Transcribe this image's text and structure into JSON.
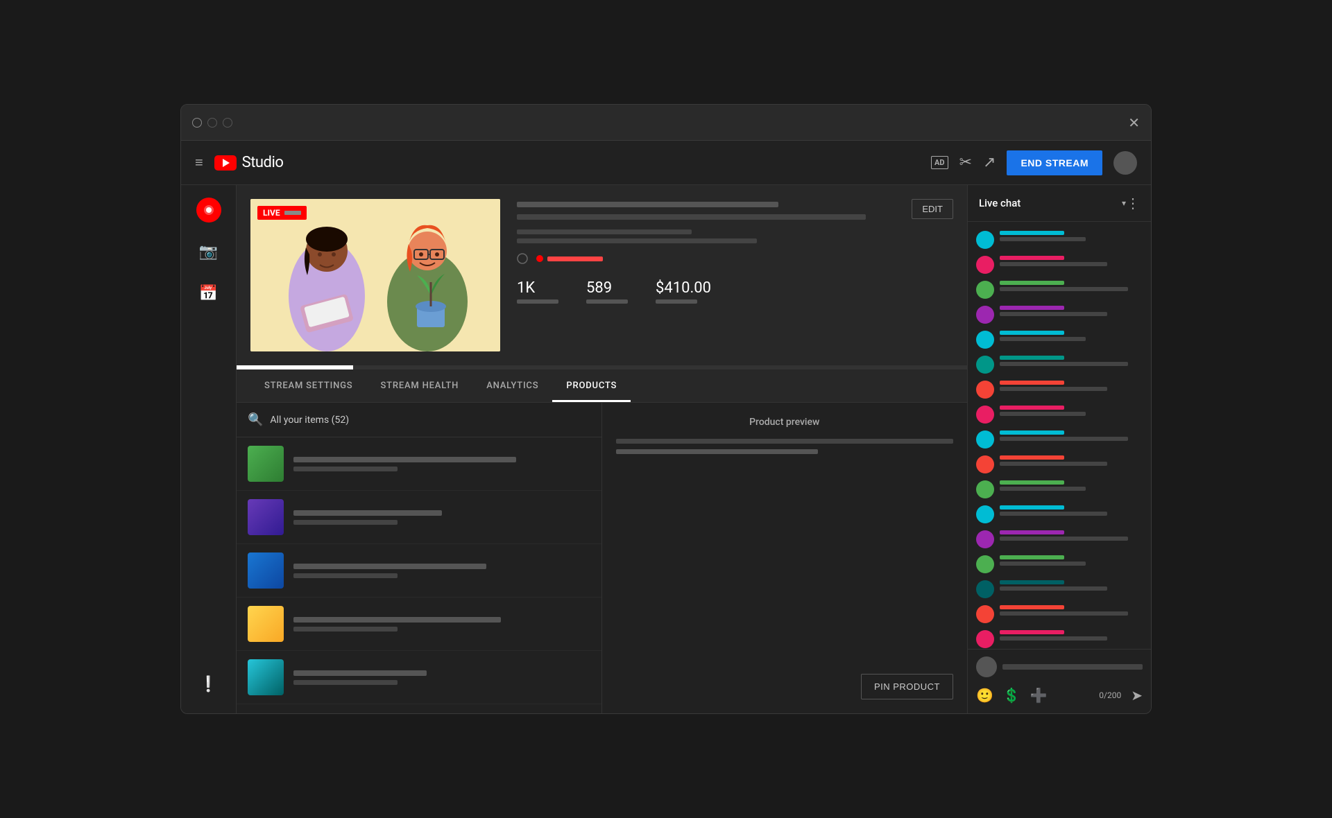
{
  "window": {
    "title": "YouTube Studio"
  },
  "header": {
    "hamburger_icon": "≡",
    "logo_text": "Studio",
    "ad_label": "AD",
    "end_stream_label": "END STREAM"
  },
  "stream": {
    "live_badge": "LIVE",
    "edit_button": "EDIT",
    "stats": {
      "viewers": "1K",
      "likes": "589",
      "revenue": "$410.00"
    }
  },
  "tabs": [
    {
      "id": "stream-settings",
      "label": "STREAM SETTINGS",
      "active": false
    },
    {
      "id": "stream-health",
      "label": "STREAM HEALTH",
      "active": false
    },
    {
      "id": "analytics",
      "label": "ANALYTICS",
      "active": false
    },
    {
      "id": "products",
      "label": "PRODUCTS",
      "active": true
    }
  ],
  "products": {
    "search_text": "All your items (52)",
    "preview_title": "Product preview",
    "pin_button": "PIN PRODUCT",
    "items": [
      {
        "id": 1,
        "color_class": "product-img-1"
      },
      {
        "id": 2,
        "color_class": "product-img-2"
      },
      {
        "id": 3,
        "color_class": "product-img-3"
      },
      {
        "id": 4,
        "color_class": "product-img-4"
      },
      {
        "id": 5,
        "color_class": "product-img-5"
      }
    ]
  },
  "chat": {
    "title": "Live chat",
    "dropdown_icon": "▾",
    "more_icon": "⋮",
    "char_count": "0/200",
    "avatars": [
      {
        "color": "#00bcd4"
      },
      {
        "color": "#e91e63"
      },
      {
        "color": "#4caf50"
      },
      {
        "color": "#9c27b0"
      },
      {
        "color": "#00bcd4"
      },
      {
        "color": "#009688"
      },
      {
        "color": "#f44336"
      },
      {
        "color": "#e91e63"
      },
      {
        "color": "#00bcd4"
      },
      {
        "color": "#f44336"
      },
      {
        "color": "#4caf50"
      },
      {
        "color": "#00bcd4"
      },
      {
        "color": "#9c27b0"
      },
      {
        "color": "#4caf50"
      },
      {
        "color": "#006064"
      },
      {
        "color": "#f44336"
      },
      {
        "color": "#e91e63"
      },
      {
        "color": "#00bcd4"
      },
      {
        "color": "#009688"
      },
      {
        "color": "#e91e63"
      },
      {
        "color": "#4caf50"
      }
    ],
    "name_bar_colors": [
      "#00bcd4",
      "#e91e63",
      "#4caf50",
      "#9c27b0",
      "#00bcd4",
      "#009688",
      "#f44336",
      "#e91e63",
      "#00bcd4",
      "#f44336",
      "#4caf50",
      "#00bcd4",
      "#9c27b0",
      "#4caf50",
      "#006064",
      "#f44336",
      "#e91e63",
      "#00bcd4",
      "#009688",
      "#e91e63",
      "#4caf50"
    ]
  }
}
